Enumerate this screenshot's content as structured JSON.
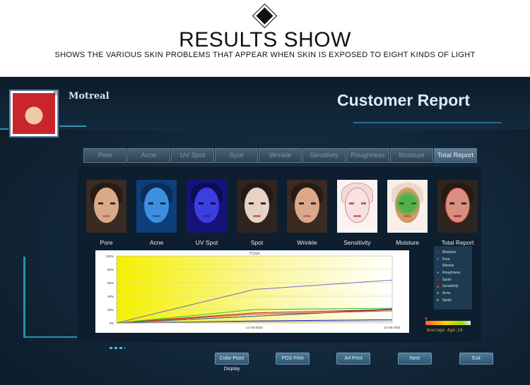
{
  "banner": {
    "title": "RESULTS SHOW",
    "subtitle": "SHOWS THE VARIOUS SKIN PROBLEMS THAT APPEAR WHEN SKIN IS EXPOSED TO EIGHT KINDS OF LIGHT"
  },
  "app": {
    "brand": "Motreal",
    "report_title": "Customer Report",
    "logo_mark": "®"
  },
  "tabs": [
    {
      "label": "Pore"
    },
    {
      "label": "Acne"
    },
    {
      "label": "UV Spot"
    },
    {
      "label": "Spot"
    },
    {
      "label": "Wrinkle"
    },
    {
      "label": "Sensitivty"
    },
    {
      "label": "Roughness"
    },
    {
      "label": "Moisture"
    },
    {
      "label": "Total Report"
    }
  ],
  "active_tab": "Total Report",
  "faces": [
    {
      "label": "Pore",
      "style": "natural"
    },
    {
      "label": "Acne",
      "style": "blue"
    },
    {
      "label": "UV Spot",
      "style": "violet"
    },
    {
      "label": "Spot",
      "style": "pale"
    },
    {
      "label": "Wrinkle",
      "style": "natural"
    },
    {
      "label": "Sensitivity",
      "style": "sketch"
    },
    {
      "label": "Moisture",
      "style": "green-map"
    },
    {
      "label": "Total Report",
      "style": "overlay"
    }
  ],
  "chart_data": {
    "type": "line",
    "title": "TChart",
    "x": [
      "",
      "12-28-2016",
      "12-28-2016"
    ],
    "ylim": [
      0,
      100
    ],
    "yticks": [
      "100%",
      "80%",
      "60%",
      "40%",
      "20%",
      "0%"
    ],
    "series": [
      {
        "name": "Moisture",
        "color": "#8a2b2b",
        "values": [
          0,
          10,
          20
        ]
      },
      {
        "name": "Pore",
        "color": "#2f6fb0",
        "values": [
          0,
          10,
          21
        ]
      },
      {
        "name": "Wrinkle",
        "color": "#2b2bd6",
        "values": [
          0,
          3,
          5
        ]
      },
      {
        "name": "Roughness",
        "color": "#7070cc",
        "values": [
          0,
          50,
          64
        ]
      },
      {
        "name": "Spots",
        "color": "#b02020",
        "values": [
          0,
          15,
          20
        ]
      },
      {
        "name": "Sensitivity",
        "color": "#d84040",
        "values": [
          0,
          13,
          18
        ]
      },
      {
        "name": "Acne",
        "color": "#30c030",
        "values": [
          0,
          20,
          22
        ]
      },
      {
        "name": "Spots",
        "color": "#8a8a8a",
        "values": [
          0,
          2,
          3
        ]
      }
    ]
  },
  "age": {
    "marker": "▼",
    "text": "Average Age:24"
  },
  "buttons": [
    {
      "label": "Color Point Display"
    },
    {
      "label": "POS Print"
    },
    {
      "label": "A4 Print"
    },
    {
      "label": "Next"
    },
    {
      "label": "Exit"
    }
  ]
}
